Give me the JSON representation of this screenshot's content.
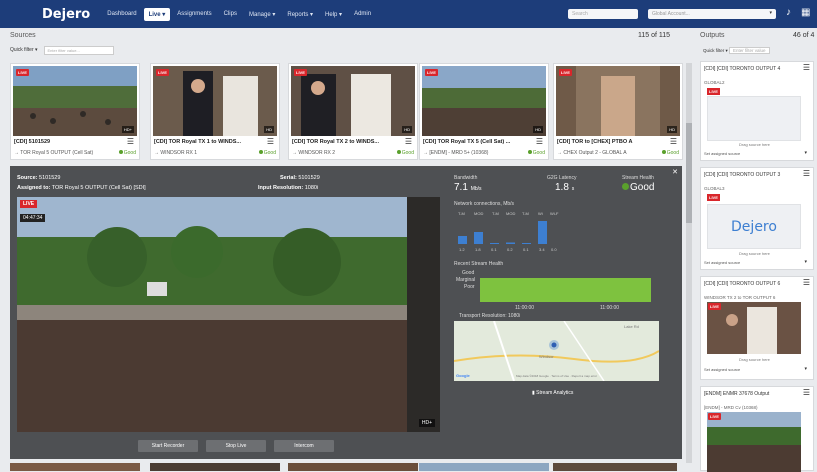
{
  "nav": {
    "logo": "Dejero",
    "items": [
      "Dashboard",
      "Live ▾",
      "Assignments",
      "Clips",
      "Manage ▾",
      "Reports ▾",
      "Help ▾",
      "Admin"
    ],
    "search_placeholder": "Search",
    "select_placeholder": "Global Account..."
  },
  "sources": {
    "title": "Sources",
    "count": "115 of 115",
    "quick_filter": "Quick filter ▾",
    "filter_placeholder": "Enter filter value..."
  },
  "outputs": {
    "title": "Outputs",
    "count": "46 of 4",
    "quick_filter": "Quick filter ▾",
    "filter_placeholder": "Enter filter value"
  },
  "cards": [
    {
      "title": "[CDI] 5101529",
      "sub": "→ TOR Royal 5 OUTPUT (Cell Sat)",
      "status": "Good",
      "hd": "HD+"
    },
    {
      "title": "[CDI] TOR Royal TX 1 to WINDS...",
      "sub": "→ WINDSOR RX 1",
      "status": "Good",
      "hd": "HD"
    },
    {
      "title": "[CDI] TOR Royal TX 2 to WINDS...",
      "sub": "→ WINDSOR RX 2",
      "status": "Good",
      "hd": "HD"
    },
    {
      "title": "[CDI] TOR Royal TX 5 (Cell Sat) ...",
      "sub": "→ [ENDM] - MRD 5+ (10368)",
      "status": "Good",
      "hd": "HD"
    },
    {
      "title": "[CDI] TOR to [CHEX] PTBO A",
      "sub": "→ CHEX Output 2 - GLOBAL A",
      "status": "Good",
      "hd": "HD"
    }
  ],
  "detail": {
    "source_label": "Source:",
    "source_value": "5101529",
    "assigned_label": "Assigned to:",
    "assigned_value": "TOR Royal 5 OUTPUT (Cell Sat) [SDI]",
    "serial_label": "Serial:",
    "serial_value": "5101529",
    "input_res_label": "Input Resolution:",
    "input_res_value": "1080i",
    "live": "LIVE",
    "time": "04:47:34",
    "hd": "HD+",
    "bandwidth_h": "Bandwidth",
    "bandwidth_v": "7.1",
    "bandwidth_u": "Mb/s",
    "latency_h": "G2G Latency",
    "latency_v": "1.8",
    "latency_u": "s",
    "health_h": "Stream Health",
    "health_v": "Good",
    "network_title": "Network connections, Mb/s",
    "net_labels": [
      "T-M",
      "MOD",
      "T-M",
      "MOD",
      "T-M",
      "Wi",
      "Wi-F"
    ],
    "net_values": [
      "1.2",
      "1.8",
      "0.1",
      "0.2",
      "0.1",
      "3.4",
      "0.0"
    ],
    "health_title": "Recent Stream Health",
    "health_levels": [
      "Good",
      "Marginal",
      "Poor"
    ],
    "health_times": [
      "11:00:00",
      "11:00:00"
    ],
    "transport_res": "Transport Resolution: 1080i",
    "map_labels": [
      "Lake Rd",
      "Windsor",
      "Google",
      "Map data ©2018 Google · Terms of Use · Report a map error"
    ],
    "analytics": "Stream Analytics",
    "buttons": [
      "Start Recorder",
      "Stop Live",
      "Intercom"
    ]
  },
  "outputs_cards": [
    {
      "title": "[CDI] [CDI] TORONTO OUTPUT 4",
      "field": "GLOBAL2",
      "hint": "Drag source here",
      "select": "Set assigned source"
    },
    {
      "title": "[CDI] [CDI] TORONTO OUTPUT 3",
      "field": "GLOBAL3",
      "hint": "Drag source here",
      "select": "Set assigned source",
      "logo": "Dejero"
    },
    {
      "title": "[CDI] [CDI] TORONTO OUTPUT 6",
      "field": "WINDSOR TX 2 to TOR OUTPUT 6",
      "hint": "Drag source here",
      "select": "Set assigned source"
    },
    {
      "title": "[ENDM] ENMR 37678 Output",
      "field": "[ENDM] - MRD Cv (10368)",
      "hint": "",
      "select": ""
    }
  ],
  "colors": {
    "nav": "#1d3d7a",
    "live": "#d9262b",
    "good": "#5aa02c",
    "panel": "#4e5053"
  }
}
